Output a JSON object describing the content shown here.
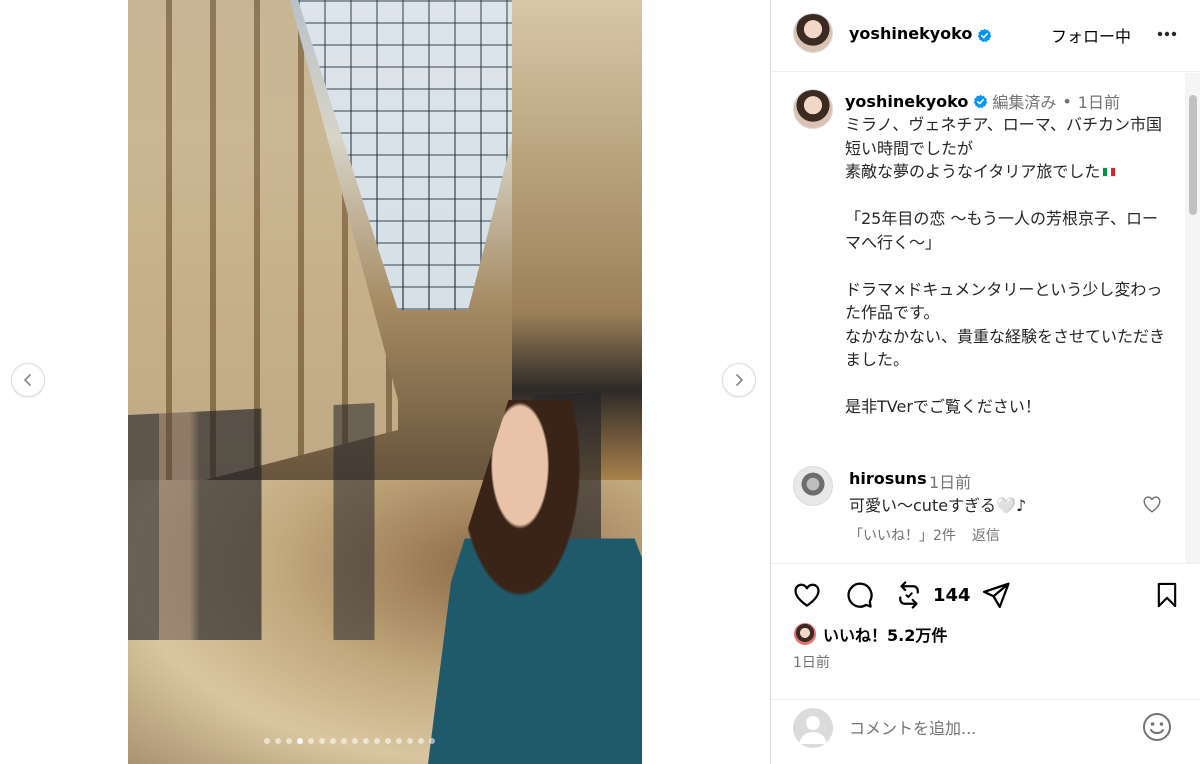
{
  "post": {
    "slide_count": 16,
    "active_slide": 4
  },
  "header": {
    "username": "yoshinekyoko",
    "follow_state": "フォロー中"
  },
  "caption": {
    "username": "yoshinekyoko",
    "edited": "編集済み",
    "separator": "•",
    "time": "1日前",
    "lines": [
      "ミラノ、ヴェネチア、ローマ、バチカン市国",
      "短い時間でしたが",
      "素敵な夢のようなイタリア旅でした",
      "",
      "「25年目の恋 〜もう一人の芳根京子、ローマへ行く〜」",
      "",
      "ドラマ×ドキュメンタリーという少し変わった作品です。",
      "なかなかない、貴重な経験をさせていただきました。",
      "",
      "是非TVerでご覧ください！"
    ]
  },
  "reply": {
    "username": "hirosuns",
    "time": "1日前",
    "text": "可愛い〜cuteすぎる🤍♪",
    "likes": "「いいね！」2件",
    "reply_label": "返信"
  },
  "actions": {
    "repost_count": "144",
    "likes_text": "いいね！5.2万件",
    "post_time": "1日前"
  },
  "add_comment": {
    "placeholder": "コメントを追加..."
  },
  "colors": {
    "verified": "#0095f6",
    "text": "#262626",
    "muted": "#737373"
  }
}
